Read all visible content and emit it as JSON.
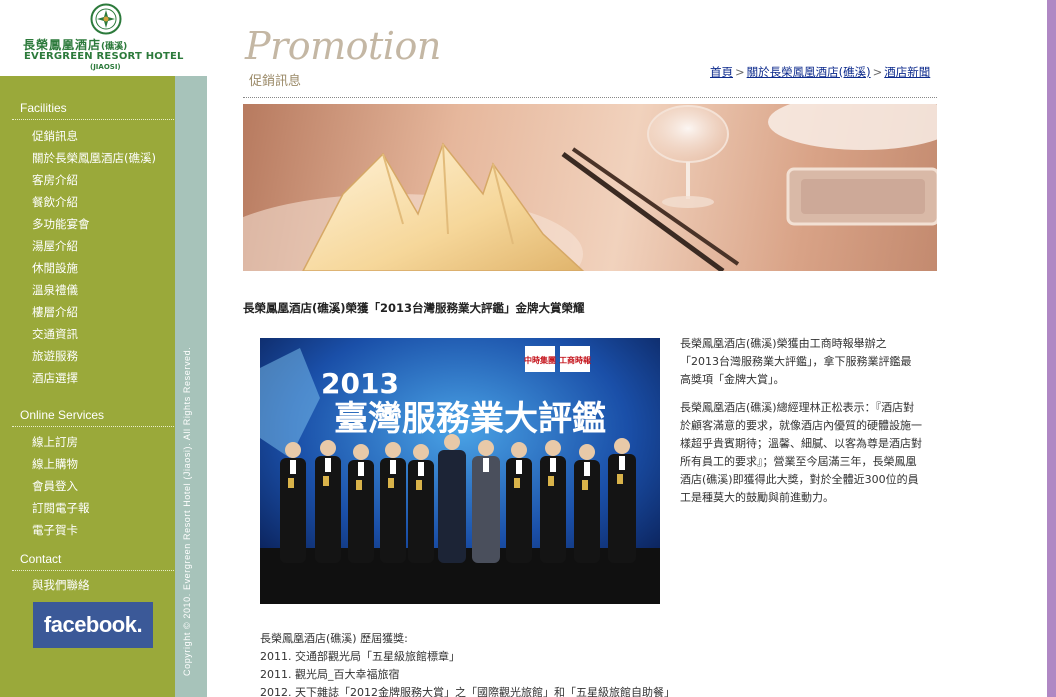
{
  "logo": {
    "name_cn": "長榮鳳凰酒店",
    "name_cn_branch": "(礁溪)",
    "name_en": "EVERGREEN RESORT HOTEL",
    "name_en_sub": "(JIAOSI)"
  },
  "sidebar": {
    "facilities_heading": "Facilities",
    "facilities": [
      "促銷訊息",
      "關於長榮鳳凰酒店(礁溪)",
      "客房介紹",
      "餐飲介紹",
      "多功能宴會",
      "湯屋介紹",
      "休閒設施",
      "溫泉禮儀",
      "樓層介紹",
      "交通資訊",
      "旅遊服務",
      "酒店選擇"
    ],
    "online_heading": "Online Services",
    "online": [
      "線上訂房",
      "線上購物",
      "會員登入",
      "訂閱電子報",
      "電子賀卡"
    ],
    "contact_heading": "Contact",
    "contact": [
      "與我們聯絡"
    ],
    "facebook_label": "facebook.",
    "copyright": "Copyright © 2010. Evergreen Resort Hotel (Jiaosi). All Rights Reserved."
  },
  "header": {
    "title": "Promotion",
    "subtitle": "促銷訊息"
  },
  "breadcrumb": {
    "home": "首頁",
    "about": "關於長榮鳳凰酒店(礁溪)",
    "news": "酒店新聞",
    "separator": ">"
  },
  "article": {
    "title": "長榮鳳凰酒店(礁溪)榮獲「2013台灣服務業大評鑑」金牌大賞榮耀",
    "paragraph1": "長榮鳳凰酒店(礁溪)榮獲由工商時報舉辦之「2013台灣服務業大評鑑」，拿下服務業評鑑最高獎項「金牌大賞」。",
    "paragraph2": "長榮鳳凰酒店(礁溪)總經理林正松表示：『酒店對於顧客滿意的要求，就像酒店內優質的硬體設施一樣超乎貴賓期待；溫馨、細膩、以客為尊是酒店對所有員工的要求』；營業至今屆滿三年，長榮鳳凰酒店(礁溪)即獲得此大獎，對於全體近300位的員工是種莫大的鼓勵與前進動力。",
    "photo": {
      "year": "2013",
      "headline": "臺灣服務業大評鑑",
      "logo_left": "中時集團",
      "logo_right": "工商時報"
    },
    "history_heading": "長榮鳳凰酒店(礁溪) 歷屆獲獎:",
    "history": [
      "2011. 交通部觀光局「五星級旅館標章」",
      "2011. 觀光局_百大幸福旅宿",
      "2012. 天下雜誌「2012金牌服務大賞」之「國際觀光旅館」和「五星級旅館自助餐」"
    ]
  }
}
